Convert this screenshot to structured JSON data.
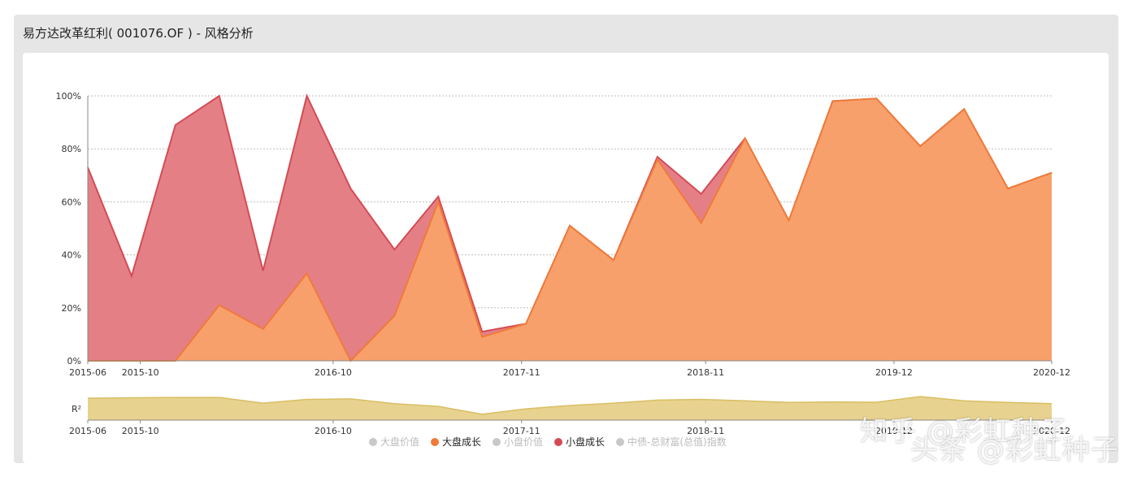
{
  "title": "易方达改革红利( 001076.OF ) - 风格分析",
  "colors": {
    "small_growth_fill": "#e57f86",
    "small_growth_line": "#d44b55",
    "large_growth_fill": "#f8a06b",
    "large_growth_line": "#ee7b3a",
    "r2_fill": "#e8d28f",
    "r2_line": "#d8be63",
    "inactive": "#c8c8c8"
  },
  "chart_data": {
    "type": "area",
    "ylim": [
      0,
      100
    ],
    "yticks": [
      "0%",
      "20%",
      "40%",
      "60%",
      "80%",
      "100%"
    ],
    "x_tick_labels": [
      "2015-06",
      "2015-10",
      "2016-10",
      "2017-11",
      "2018-11",
      "2019-12",
      "2020-12"
    ],
    "series": [
      {
        "name": "大盘成长",
        "color": "#ee7b3a",
        "x": [
          "2015-06",
          "2015-09",
          "2015-12",
          "2016-03",
          "2016-06",
          "2016-09",
          "2016-12",
          "2017-03",
          "2017-06",
          "2017-09",
          "2017-12",
          "2018-03",
          "2018-06",
          "2018-09",
          "2018-12",
          "2019-03",
          "2019-06",
          "2019-09",
          "2019-12",
          "2020-03",
          "2020-06",
          "2020-09",
          "2020-12"
        ],
        "values": [
          0,
          0,
          0,
          21,
          12,
          33,
          0,
          17,
          60,
          9,
          14,
          51,
          38,
          76,
          52,
          84,
          53,
          98,
          99,
          81,
          95,
          65,
          71
        ]
      },
      {
        "name": "小盘成长",
        "color": "#d44b55",
        "x": [
          "2015-06",
          "2015-09",
          "2015-12",
          "2016-03",
          "2016-06",
          "2016-09",
          "2016-12",
          "2017-03",
          "2017-06",
          "2017-09",
          "2017-12",
          "2018-03",
          "2018-06",
          "2018-09",
          "2018-12",
          "2019-03",
          "2019-06",
          "2019-09",
          "2019-12",
          "2020-03",
          "2020-06",
          "2020-09",
          "2020-12"
        ],
        "values": [
          73,
          32,
          89,
          100,
          34,
          100,
          65,
          42,
          62,
          11,
          14,
          51,
          38,
          77,
          63,
          84,
          53,
          98,
          99,
          81,
          95,
          65,
          71
        ]
      }
    ],
    "r2": {
      "label": "R²",
      "values": [
        0.93,
        0.95,
        0.96,
        0.96,
        0.72,
        0.88,
        0.9,
        0.7,
        0.58,
        0.25,
        0.48,
        0.62,
        0.72,
        0.85,
        0.88,
        0.82,
        0.75,
        0.77,
        0.76,
        1.0,
        0.82,
        0.75,
        0.7
      ]
    },
    "legend": [
      {
        "name": "大盘价值",
        "color": "#c8c8c8",
        "active": false
      },
      {
        "name": "大盘成长",
        "color": "#ee7b3a",
        "active": true
      },
      {
        "name": "小盘价值",
        "color": "#c8c8c8",
        "active": false
      },
      {
        "name": "小盘成长",
        "color": "#d44b55",
        "active": true
      },
      {
        "name": "中债-总财富(总值)指数",
        "color": "#c8c8c8",
        "active": false
      }
    ],
    "grid": true,
    "legend_position": "bottom"
  },
  "watermarks": [
    "知乎 @彩虹种子",
    "头条 @彩虹种子"
  ]
}
